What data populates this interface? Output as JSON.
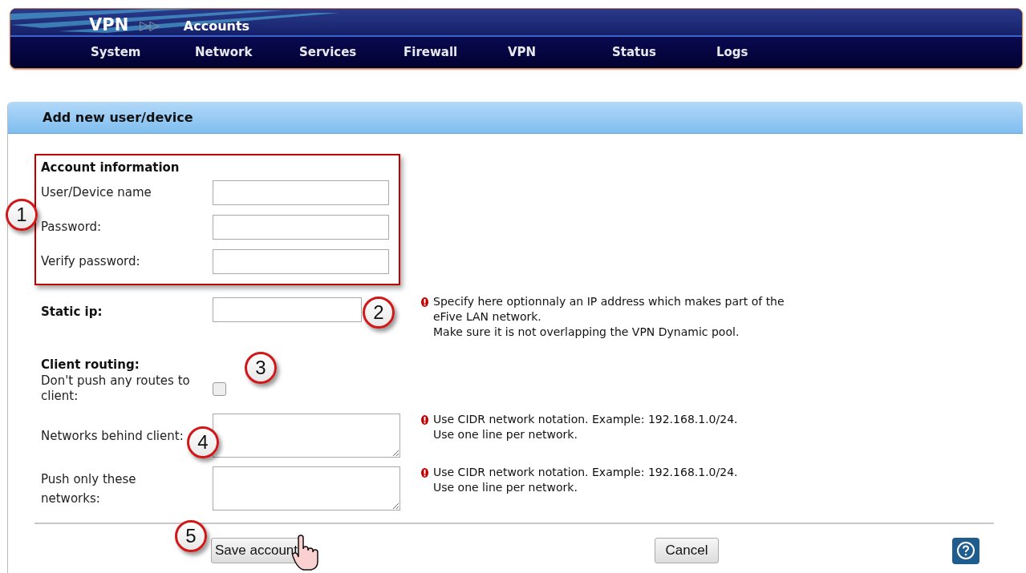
{
  "header": {
    "section": "VPN",
    "separator": "▷▷",
    "page": "Accounts",
    "nav": [
      "System",
      "Network",
      "Services",
      "Firewall",
      "VPN",
      "Status",
      "Logs"
    ]
  },
  "panel": {
    "title": "Add new user/device",
    "account_info": {
      "heading": "Account information",
      "fields": [
        {
          "label": "User/Device name"
        },
        {
          "label": "Password:"
        },
        {
          "label": "Verify password:"
        }
      ]
    },
    "static_ip": {
      "label": "Static ip:",
      "hint": [
        "Specify here optionnaly an IP address which makes part of the eFive LAN network.",
        "Make sure it is not overlapping the VPN Dynamic pool."
      ]
    },
    "client_routing": {
      "heading": "Client routing:",
      "rows": [
        {
          "kind": "checkbox",
          "label": "Don't push any routes to client:",
          "checked": false
        },
        {
          "kind": "textarea",
          "label": "Networks behind client:",
          "hint": [
            "Use CIDR network notation. Example: 192.168.1.0/24.",
            "Use one line per network."
          ]
        },
        {
          "kind": "textarea",
          "label": "Push only these networks:",
          "hint": [
            "Use CIDR network notation. Example: 192.168.1.0/24.",
            "Use one line per network."
          ]
        }
      ]
    },
    "buttons": [
      "Save account",
      "Cancel"
    ]
  },
  "callouts": [
    "1",
    "2",
    "3",
    "4",
    "5"
  ]
}
